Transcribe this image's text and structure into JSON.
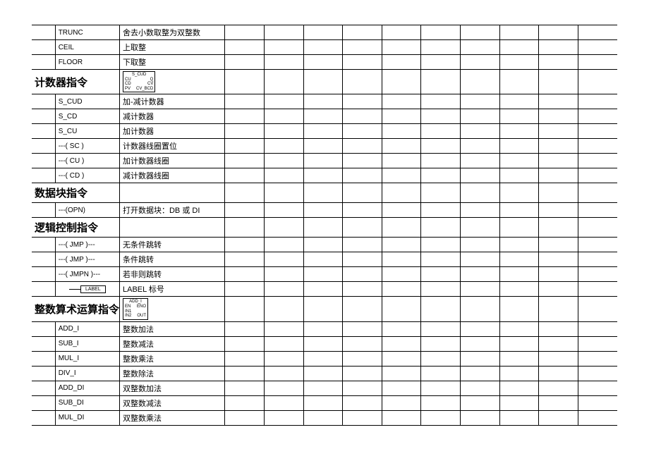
{
  "rows": [
    {
      "t": "data",
      "code": "TRUNC",
      "desc": "舍去小数取整为双整数"
    },
    {
      "t": "data",
      "code": "CEIL",
      "desc": "上取整"
    },
    {
      "t": "data",
      "code": "FLOOR",
      "desc": "下取整"
    },
    {
      "t": "section",
      "title": "计数器指令",
      "diag": "cud"
    },
    {
      "t": "data",
      "code": "S_CUD",
      "desc": "加-减计数器"
    },
    {
      "t": "data",
      "code": "S_CD",
      "desc": "减计数器"
    },
    {
      "t": "data",
      "code": "S_CU",
      "desc": "加计数器"
    },
    {
      "t": "data",
      "code": "---( SC )",
      "desc": "计数器线圈置位"
    },
    {
      "t": "data",
      "code": "---( CU )",
      "desc": "加计数器线圈"
    },
    {
      "t": "data",
      "code": "---( CD )",
      "desc": "减计数器线圈"
    },
    {
      "t": "section",
      "title": "数据块指令"
    },
    {
      "t": "data",
      "code": "---(OPN)",
      "desc": "打开数据块：DB 或 DI"
    },
    {
      "t": "section",
      "title": "逻辑控制指令"
    },
    {
      "t": "data",
      "code": "---( JMP )---",
      "desc": "无条件跳转"
    },
    {
      "t": "data",
      "code": "---( JMP )---",
      "desc": "条件跳转"
    },
    {
      "t": "data",
      "code": "---( JMPN )---",
      "desc": "若非则跳转"
    },
    {
      "t": "data",
      "code_html": "label",
      "desc": "LABEL 标号"
    },
    {
      "t": "section",
      "title": "整数算术运算指令",
      "diag": "addi"
    },
    {
      "t": "data",
      "code": "ADD_I",
      "desc": "整数加法"
    },
    {
      "t": "data",
      "code": "SUB_I",
      "desc": "整数减法"
    },
    {
      "t": "data",
      "code": "MUL_I",
      "desc": "整数乘法"
    },
    {
      "t": "data",
      "code": "DIV_I",
      "desc": "整数除法"
    },
    {
      "t": "data",
      "code": "ADD_DI",
      "desc": "双整数加法"
    },
    {
      "t": "data",
      "code": "SUB_DI",
      "desc": "双整数减法"
    },
    {
      "t": "data",
      "code": "MUL_DI",
      "desc": "双整数乘法"
    }
  ],
  "extra_cols": 10,
  "diag": {
    "cud": {
      "title": "S_CUD",
      "pins": [
        [
          "CU",
          "Q"
        ],
        [
          "CD",
          "CV"
        ],
        [
          "PV",
          "CV_BCD"
        ]
      ]
    },
    "addi": {
      "title": "ADD_I",
      "pins": [
        [
          "EN",
          "ENO"
        ],
        [
          "IN1",
          ""
        ],
        [
          "IN2",
          "OUT"
        ]
      ]
    },
    "label_text": "LABEL"
  }
}
